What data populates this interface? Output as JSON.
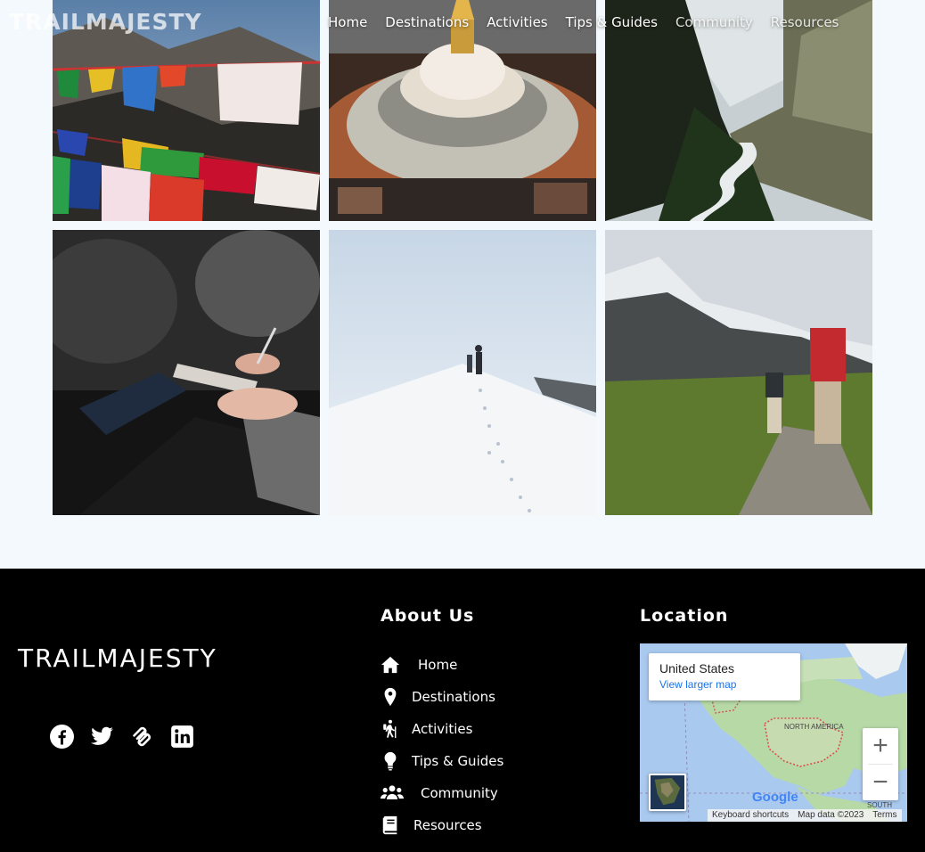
{
  "header": {
    "logo": "TRAILMAJESTY",
    "nav": [
      "Home",
      "Destinations",
      "Activities",
      "Tips & Guides",
      "Community",
      "Resources"
    ]
  },
  "gallery": {
    "images": [
      {
        "subject": "prayer-flags"
      },
      {
        "subject": "boudhanath-stupa"
      },
      {
        "subject": "mountain-river-valley"
      },
      {
        "subject": "people-taking-notes"
      },
      {
        "subject": "snow-ridge-climbers"
      },
      {
        "subject": "hikers-mountain-trail"
      }
    ]
  },
  "footer": {
    "logo": "TRAILMAJESTY",
    "socials": [
      "facebook-icon",
      "twitter-icon",
      "squarespace-icon",
      "linkedin-icon"
    ],
    "about_title": "About Us",
    "links": [
      {
        "icon": "home-icon",
        "label": "Home"
      },
      {
        "icon": "map-pin-icon",
        "label": "Destinations"
      },
      {
        "icon": "hiking-icon",
        "label": "Activities"
      },
      {
        "icon": "lightbulb-icon",
        "label": "Tips & Guides"
      },
      {
        "icon": "users-icon",
        "label": "Community"
      },
      {
        "icon": "book-icon",
        "label": "Resources"
      }
    ],
    "location_title": "Location",
    "map": {
      "place": "United States",
      "larger_link": "View larger map",
      "zoom_in": "+",
      "zoom_out": "−",
      "north_america_label": "NORTH AMERICA",
      "south_label": "SOUTH",
      "google": "Google",
      "keyboard": "Keyboard shortcuts",
      "map_data": "Map data ©2023",
      "terms": "Terms"
    }
  }
}
